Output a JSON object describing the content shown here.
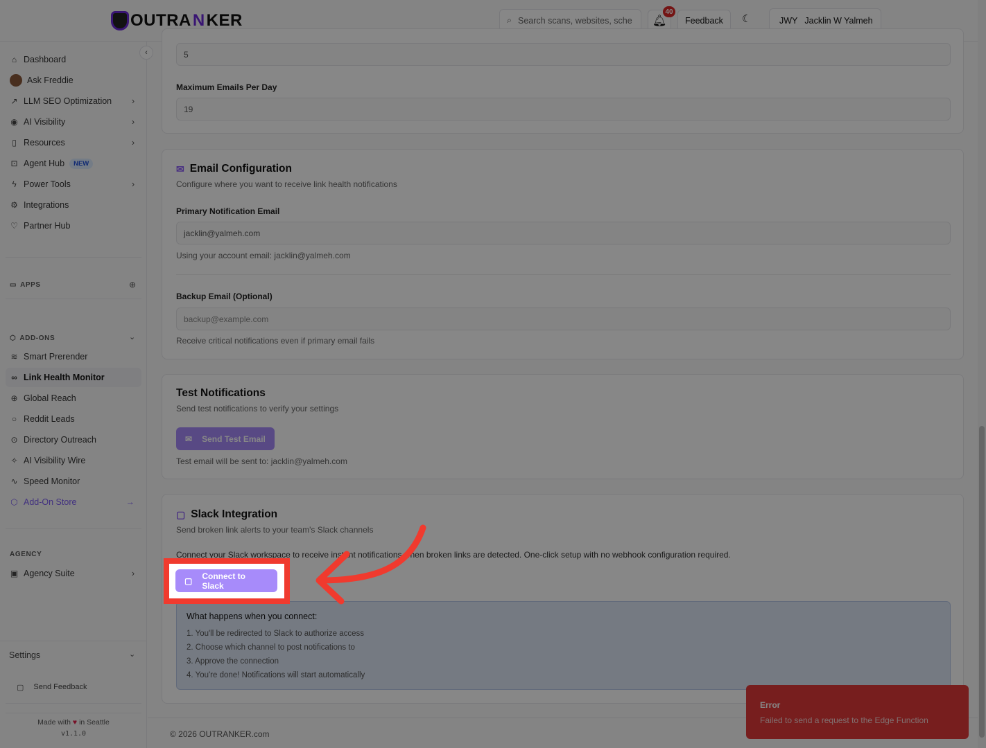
{
  "header": {
    "logo": "OUTRANKER",
    "logo_pre": "OUTRA",
    "logo_n": "N",
    "logo_post": "KER",
    "search_placeholder": "Search scans, websites, sche",
    "notifications_count": "40",
    "feedback": "Feedback",
    "user_initials": "JWY",
    "user_name": "Jacklin W Yalmeh"
  },
  "sidebar": {
    "items": [
      {
        "label": "Dashboard",
        "icon": "home"
      },
      {
        "label": "Ask Freddie",
        "icon": "avatar"
      },
      {
        "label": "LLM SEO Optimization",
        "icon": "trend"
      },
      {
        "label": "AI Visibility",
        "icon": "eye"
      },
      {
        "label": "Resources",
        "icon": "book"
      },
      {
        "label": "Agent Hub",
        "icon": "bot",
        "badge": "NEW"
      },
      {
        "label": "Power Tools",
        "icon": "zap"
      },
      {
        "label": "Integrations",
        "icon": "gear"
      },
      {
        "label": "Partner Hub",
        "icon": "handshake"
      }
    ],
    "apps": "APPS",
    "addons": "ADD-ONS",
    "addon_items": [
      {
        "label": "Smart Prerender"
      },
      {
        "label": "Link Health Monitor"
      },
      {
        "label": "Global Reach"
      },
      {
        "label": "Reddit Leads"
      },
      {
        "label": "Directory Outreach"
      },
      {
        "label": "AI Visibility Wire"
      },
      {
        "label": "Speed Monitor"
      },
      {
        "label": "Add-On Store"
      }
    ],
    "agency": "AGENCY",
    "agency_suite": "Agency Suite",
    "settings": "Settings",
    "send_feedback": "Send Feedback",
    "made_with": "Made with",
    "in_seattle": "in Seattle",
    "version": "v1.1.0"
  },
  "limits": {
    "top_value": "5",
    "max_label": "Maximum Emails Per Day",
    "max_value": "19"
  },
  "email": {
    "title": "Email Configuration",
    "subtitle": "Configure where you want to receive link health notifications",
    "primary_label": "Primary Notification Email",
    "primary_value": "jacklin@yalmeh.com",
    "primary_help": "Using your account email: jacklin@yalmeh.com",
    "backup_label": "Backup Email (Optional)",
    "backup_placeholder": "backup@example.com",
    "backup_help": "Receive critical notifications even if primary email fails"
  },
  "test": {
    "title": "Test Notifications",
    "subtitle": "Send test notifications to verify your settings",
    "button": "Send Test Email",
    "help": "Test email will be sent to: jacklin@yalmeh.com"
  },
  "slack": {
    "title": "Slack Integration",
    "subtitle": "Send broken link alerts to your team's Slack channels",
    "desc": "Connect your Slack workspace to receive instant notifications when broken links are detected. One-click setup with no webhook configuration required.",
    "button": "Connect to Slack",
    "info_title": "What happens when you connect:",
    "steps": [
      "1. You'll be redirected to Slack to authorize access",
      "2. Choose which channel to post notifications to",
      "3. Approve the connection",
      "4. You're done! Notifications will start automatically"
    ]
  },
  "footer": {
    "copyright": "© 2026 OUTRANKER.com"
  },
  "toast": {
    "title": "Error",
    "message": "Failed to send a request to the Edge Function"
  }
}
